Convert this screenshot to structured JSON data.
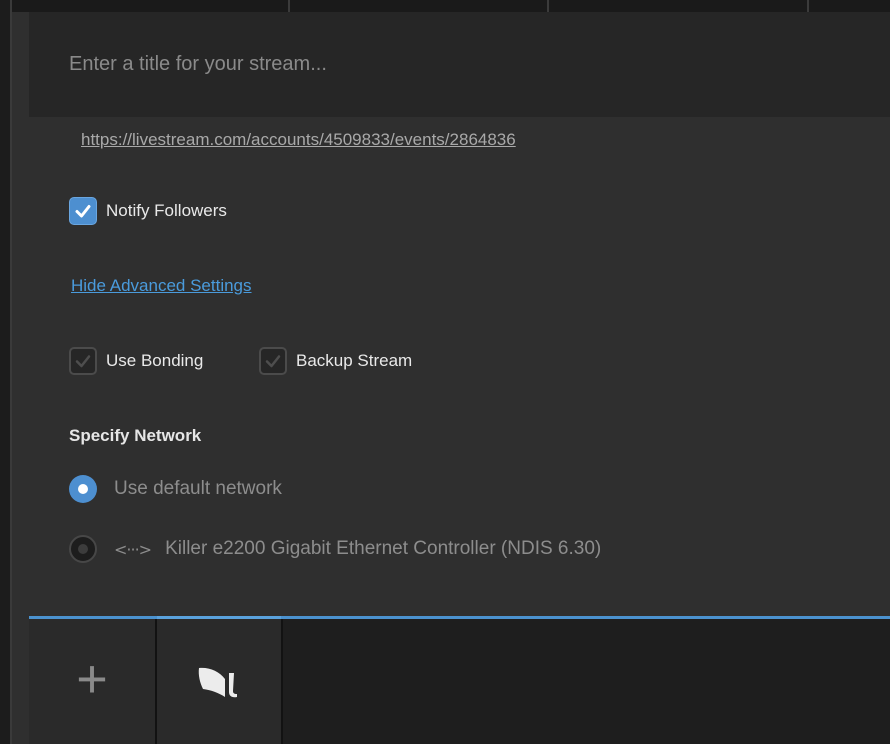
{
  "stream": {
    "title_placeholder": "Enter a title for your stream...",
    "title_value": "",
    "event_url": "https://livestream.com/accounts/4509833/events/2864836"
  },
  "options": {
    "notify_followers": {
      "label": "Notify Followers",
      "checked": true
    },
    "advanced_link": "Hide Advanced Settings",
    "use_bonding": {
      "label": "Use Bonding",
      "checked": false
    },
    "backup_stream": {
      "label": "Backup Stream",
      "checked": false
    }
  },
  "network": {
    "heading": "Specify Network",
    "options": [
      {
        "label": "Use default network",
        "selected": true
      },
      {
        "label": "Killer e2200 Gigabit Ethernet Controller (NDIS 6.30)",
        "selected": false,
        "icon": "network-arrows-icon",
        "icon_glyph": "<···>"
      }
    ]
  },
  "tabs": {
    "add_glyph": "+",
    "active_icon": "livestream-logo-icon"
  },
  "colors": {
    "accent": "#4d8fd0",
    "link": "#4a9bdc",
    "background": "#2f2f2f",
    "title_bar": "#262626"
  }
}
